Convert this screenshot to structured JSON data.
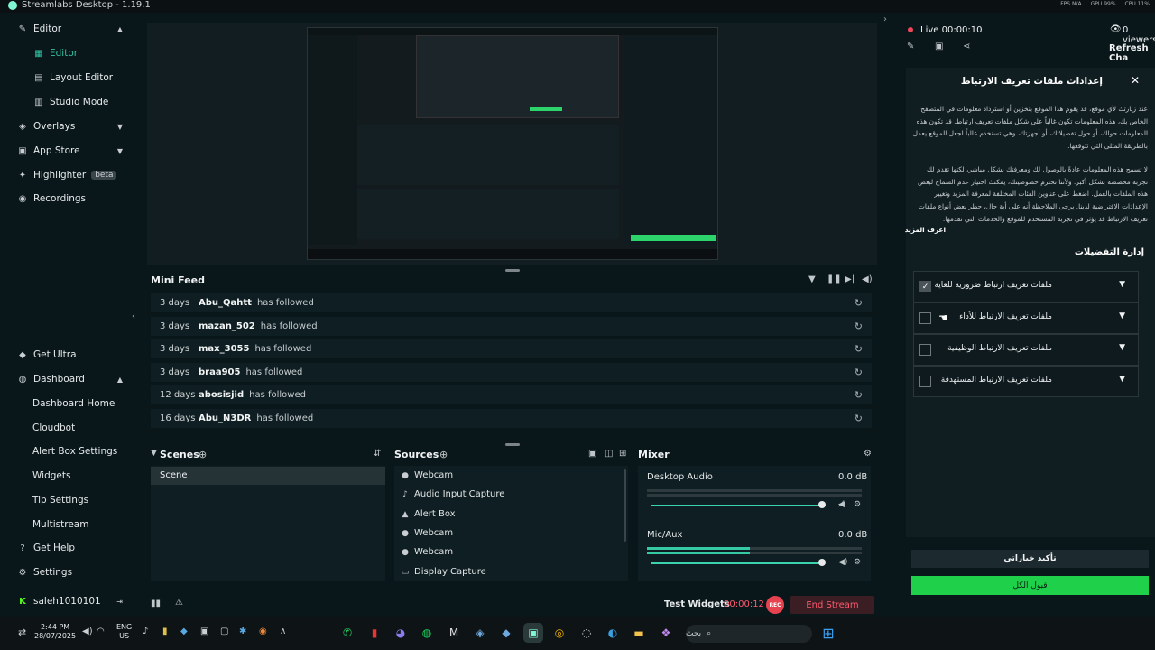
{
  "window": {
    "title": "Streamlabs Desktop - 1.19.1"
  },
  "perf": {
    "fps": "FPS N/A",
    "gpu": "GPU 99%",
    "cpu": "CPU 11%"
  },
  "sidebar": {
    "items": [
      {
        "label": "Editor",
        "icon": "brush-icon",
        "expanded": true
      },
      {
        "label": "Editor",
        "icon": "editor-icon",
        "active": true
      },
      {
        "label": "Layout Editor",
        "icon": "layout-icon"
      },
      {
        "label": "Studio Mode",
        "icon": "studio-icon"
      },
      {
        "label": "Overlays",
        "icon": "overlays-icon"
      },
      {
        "label": "App Store",
        "icon": "store-icon"
      },
      {
        "label": "Highlighter",
        "icon": "highlighter-icon",
        "badge": "beta"
      },
      {
        "label": "Recordings",
        "icon": "recordings-icon"
      },
      {
        "label": "Get Ultra",
        "icon": "ultra-icon"
      },
      {
        "label": "Dashboard",
        "icon": "dashboard-icon",
        "expanded": true
      },
      {
        "label": "Dashboard Home"
      },
      {
        "label": "Cloudbot"
      },
      {
        "label": "Alert Box Settings"
      },
      {
        "label": "Widgets"
      },
      {
        "label": "Tip Settings"
      },
      {
        "label": "Multistream"
      },
      {
        "label": "Get Help",
        "icon": "help-icon"
      },
      {
        "label": "Settings",
        "icon": "gear-icon"
      }
    ],
    "user": "saleh1010101"
  },
  "minifeed": {
    "title": "Mini Feed",
    "rows": [
      {
        "when": "3 days",
        "who": "Abu_Qahtt",
        "what": "has followed"
      },
      {
        "when": "3 days",
        "who": "mazan_502",
        "what": "has followed"
      },
      {
        "when": "3 days",
        "who": "max_3055",
        "what": "has followed"
      },
      {
        "when": "3 days",
        "who": "braa905",
        "what": "has followed"
      },
      {
        "when": "12 days",
        "who": "abosisjid",
        "what": "has followed"
      },
      {
        "when": "16 days",
        "who": "Abu_N3DR",
        "what": "has followed"
      }
    ]
  },
  "scenes": {
    "title": "Scenes",
    "items": [
      "Scene"
    ]
  },
  "sources": {
    "title": "Sources",
    "items": [
      {
        "label": "Webcam",
        "icon": "person-icon"
      },
      {
        "label": "Audio Input Capture",
        "icon": "mic-icon"
      },
      {
        "label": "Alert Box",
        "icon": "bell-icon"
      },
      {
        "label": "Webcam",
        "icon": "person-icon"
      },
      {
        "label": "Webcam",
        "icon": "person-icon"
      },
      {
        "label": "Display Capture",
        "icon": "monitor-icon"
      }
    ]
  },
  "mixer": {
    "title": "Mixer",
    "channels": [
      {
        "name": "Desktop Audio",
        "db": "0.0 dB",
        "level": 0
      },
      {
        "name": "Mic/Aux",
        "db": "0.0 dB",
        "level": 0.48
      }
    ]
  },
  "footer": {
    "test_widgets": "Test Widgets",
    "timer": "00:00:12",
    "rec": "REC",
    "end_stream": "End Stream"
  },
  "live": {
    "status": "Live 00:00:10",
    "viewers": "0 viewers",
    "refresh_chat": "Refresh Cha"
  },
  "cookie": {
    "title": "إعدادات ملفات تعريف الارتباط",
    "para1": "عند زيارتك لأي موقع، قد يقوم هذا الموقع بتخزين أو استرداد معلومات في المتصفح الخاص بك، هذه المعلومات تكون غالباً على شكل ملفات تعريف ارتباط. قد تكون هذه المعلومات حولك، أو حول تفضيلاتك، أو أجهزتك، وهي تستخدم غالباً لجعل الموقع يعمل بالطريقة المثلى التي تتوقعها.",
    "para2": "لا تسمح هذه المعلومات عادةً بالوصول لك ومعرفتك بشكل مباشر، لكنها تقدم لك تجربة مخصصة بشكل أكبر. ولأننا نحترم خصوصيتك، يمكنك اختيار عدم السماح لبعض هذه الملفات بالعمل. اضغط على عناوين الفئات المختلفة لمعرفة المزيد وتغيير الإعدادات الافتراضية لدينا. يرجى الملاحظة أنه على أية حال، حظر بعض أنواع ملفات تعريف الارتباط قد يؤثر في تجربة المستخدم للموقع والخدمات التي نقدمها.",
    "learn_more": "اعرف المزيد",
    "manage_title": "إدارة التفضيلات",
    "categories": [
      {
        "label": "ملفات تعريف ارتباط ضرورية للغاية",
        "checked": true
      },
      {
        "label": "ملفات تعريف الارتباط للأداء",
        "checked": false
      },
      {
        "label": "ملفات تعريف الارتباط الوظيفية",
        "checked": false
      },
      {
        "label": "ملفات تعريف الارتباط المستهدفة",
        "checked": false
      }
    ],
    "confirm": "تأكيد خياراتي",
    "accept_all": "قبول الكل"
  },
  "taskbar": {
    "time": "2:44 PM",
    "date": "28/07/2025",
    "lang": "ENG",
    "region": "US",
    "search": "بحث"
  },
  "colors": {
    "accent": "#31c3a2",
    "accept": "#1fd14a",
    "live": "#f0455a"
  }
}
